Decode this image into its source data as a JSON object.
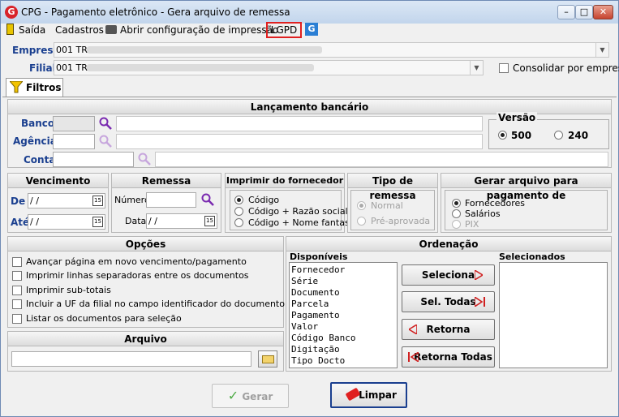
{
  "window": {
    "title": "CPG - Pagamento eletrônico - Gera arquivo de remessa",
    "min": "–",
    "max": "□",
    "close": "✕"
  },
  "menu": {
    "saida": "Saída",
    "cadastros": "Cadastros",
    "abrir": "Abrir configuração de impressão",
    "lgpd": "LGPD"
  },
  "empresa": {
    "label": "Empresa",
    "value": "001 TR"
  },
  "filial": {
    "label": "Filial",
    "value": "001 TR",
    "consolidar": "Consolidar por empresa"
  },
  "tab": {
    "label": "Filtros"
  },
  "lancamento": {
    "title": "Lançamento bancário",
    "banco": "Banco",
    "agencia": "Agência",
    "conta": "Conta"
  },
  "versao": {
    "title": "Versão",
    "opt1": "500",
    "opt2": "240"
  },
  "vencimento": {
    "title": "Vencimento",
    "de": "De",
    "ate": "Até",
    "de_value": " / /",
    "ate_value": " / /"
  },
  "remessa": {
    "title": "Remessa",
    "numero": "Número",
    "data": "Data",
    "data_value": " / /"
  },
  "imprimir": {
    "title": "Imprimir do fornecedor",
    "o1": "Código",
    "o2": "Código + Razão social",
    "o3": "Código + Nome fantasia"
  },
  "tipo": {
    "title": "Tipo de remessa",
    "o1": "Normal",
    "o2": "Pré-aprovada"
  },
  "gerar_para": {
    "title": "Gerar arquivo para pagamento de",
    "o1": "Fornecedores",
    "o2": "Salários",
    "o3": "PIX"
  },
  "opcoes": {
    "title": "Opções",
    "items": [
      "Avançar página em novo vencimento/pagamento",
      "Imprimir linhas separadoras entre os documentos",
      "Imprimir sub-totais",
      "Incluir a UF da filial no campo identificador do documento",
      "Listar os documentos para seleção"
    ]
  },
  "arquivo": {
    "title": "Arquivo"
  },
  "ordenacao": {
    "title": "Ordenação",
    "disponiveis": "Disponíveis",
    "selecionados": "Selecionados",
    "items": [
      "Fornecedor",
      "Série",
      "Documento",
      "Parcela",
      "Pagamento",
      "Valor",
      "Código Banco",
      "Digitação",
      "Tipo Docto"
    ],
    "b1": "Seleciona",
    "b2": "Sel. Todas",
    "b3": "Retorna",
    "b4": "Retorna Todas"
  },
  "footer": {
    "gerar": "Gerar",
    "limpar": "Limpar"
  },
  "colors": {
    "accent_blue": "#1a3f8f",
    "lgpd_border": "#e02020",
    "arrow_red": "#d02020",
    "check_green": "#4caa44"
  },
  "icons": [
    "app-icon",
    "exit-door-icon",
    "printer-icon",
    "google-icon",
    "filter-funnel-icon",
    "magnifier-icon",
    "calendar-icon",
    "folder-icon",
    "check-icon",
    "eraser-icon"
  ]
}
